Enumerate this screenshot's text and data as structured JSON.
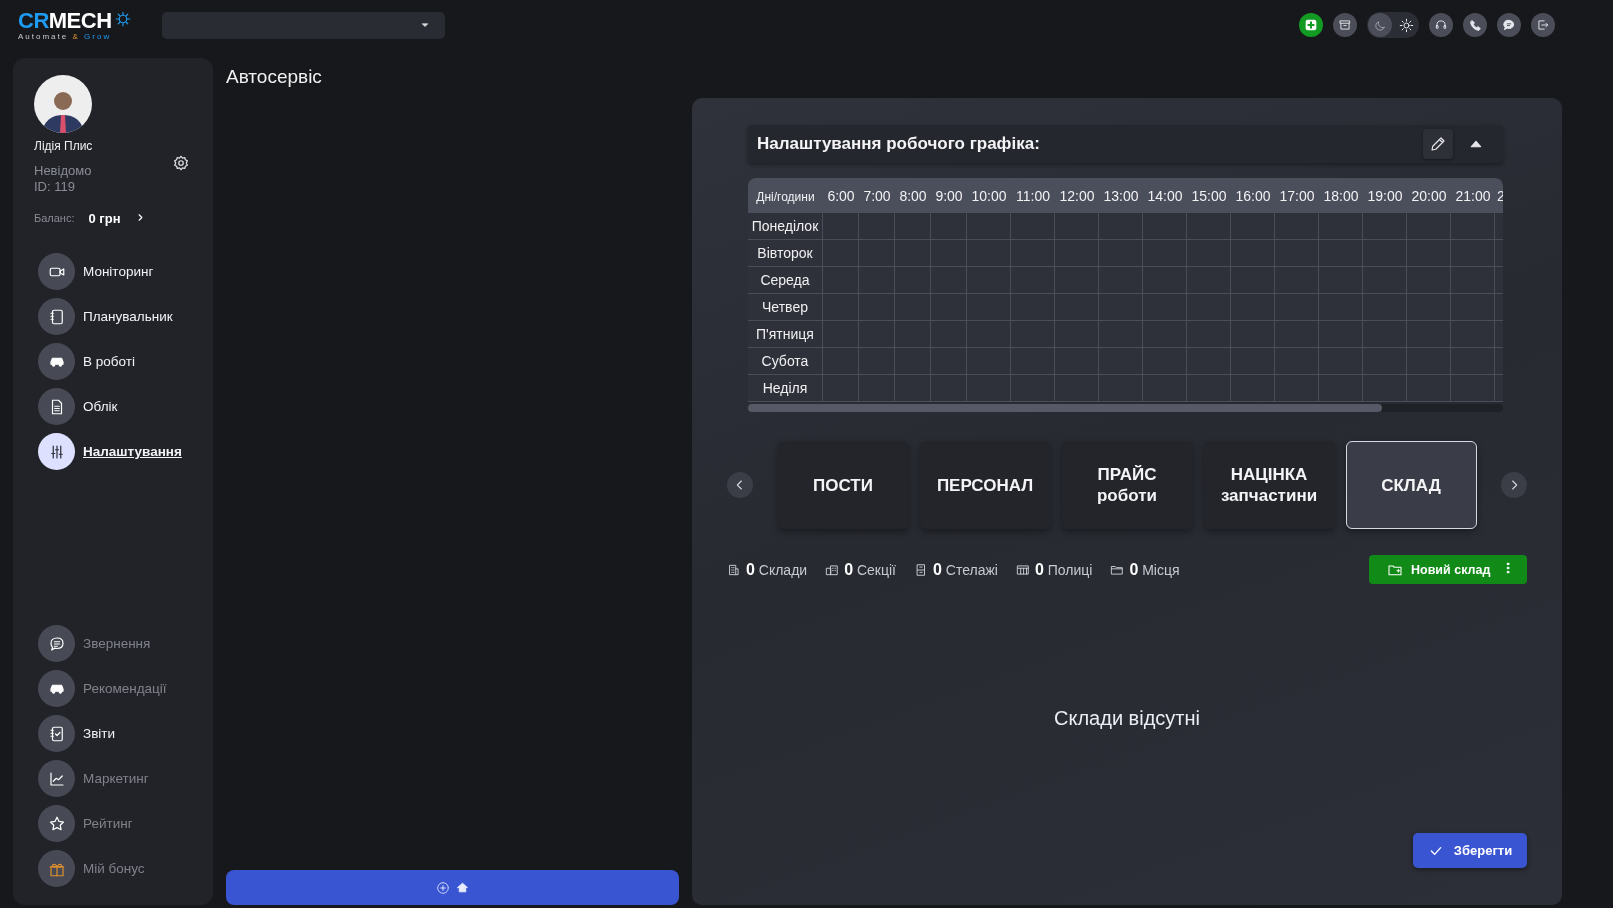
{
  "logo": {
    "wordmark": [
      "CR",
      "MECH"
    ],
    "tagline": [
      "Automate",
      "&",
      "Grow"
    ]
  },
  "theme": {
    "dark": true
  },
  "user": {
    "name": "Лідія Плис",
    "role": "Невідомо",
    "id": "ID: 119",
    "balance_label": "Баланс:",
    "balance": "0 грн"
  },
  "menu": [
    {
      "label": "Моніторинг",
      "selected": false,
      "disabled": false
    },
    {
      "label": "Планувальник",
      "selected": false,
      "disabled": false
    },
    {
      "label": "В роботі",
      "selected": false,
      "disabled": false
    },
    {
      "label": "Облік",
      "selected": false,
      "disabled": false
    },
    {
      "label": "Налаштування",
      "selected": true,
      "disabled": false
    }
  ],
  "menu_secondary": [
    {
      "label": "Звернення",
      "selected": false,
      "disabled": true
    },
    {
      "label": "Рекомендації",
      "selected": false,
      "disabled": true
    },
    {
      "label": "Звіти",
      "selected": false,
      "disabled": false
    },
    {
      "label": "Маркетинг",
      "selected": false,
      "disabled": true
    },
    {
      "label": "Рейтинг",
      "selected": false,
      "disabled": true
    },
    {
      "label": "Мій бонус",
      "selected": false,
      "disabled": true
    }
  ],
  "page_title": "Автосервіс",
  "schedule": {
    "title": "Налаштування робочого графіка:",
    "expanded": true,
    "columns": [
      "Дні/години",
      "6:00",
      "7:00",
      "8:00",
      "9:00",
      "10:00",
      "11:00",
      "12:00",
      "13:00",
      "14:00",
      "15:00",
      "16:00",
      "17:00",
      "18:00",
      "19:00",
      "20:00",
      "21:00",
      "2"
    ],
    "rows": [
      "Понеділок",
      "Вівторок",
      "Середа",
      "Четвер",
      "П'ятниця",
      "Субота",
      "Неділя"
    ]
  },
  "tabs": [
    {
      "lines": [
        "ПОСТИ"
      ],
      "selected": false
    },
    {
      "lines": [
        "ПЕРСОНАЛ"
      ],
      "selected": false
    },
    {
      "lines": [
        "ПРАЙС",
        "роботи"
      ],
      "selected": false
    },
    {
      "lines": [
        "НАЦІНКА",
        "запчастини"
      ],
      "selected": false
    },
    {
      "lines": [
        "СКЛАД"
      ],
      "selected": true
    }
  ],
  "stats": [
    "**0** Склади",
    "**0** Секції",
    "**0** Стелажі",
    "**0** Полиці",
    "**0** Місця"
  ],
  "new_button": "Новий склад",
  "empty_message": "Склади відсутні",
  "save_button": "Зберегти"
}
